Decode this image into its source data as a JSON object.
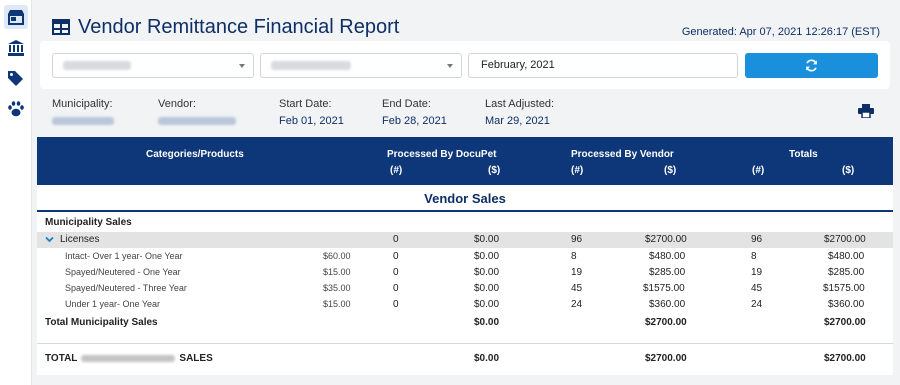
{
  "sidebar": {
    "items": [
      {
        "icon": "store-icon",
        "active": true
      },
      {
        "icon": "bank-icon"
      },
      {
        "icon": "tags-icon"
      },
      {
        "icon": "paw-icon"
      }
    ]
  },
  "header": {
    "title": "Vendor Remittance Financial Report",
    "generated": "Generated: Apr 07, 2021 12:26:17 (EST)"
  },
  "filters": {
    "period_value": "February, 2021"
  },
  "meta": {
    "municipality_label": "Municipality:",
    "vendor_label": "Vendor:",
    "start_date_label": "Start Date:",
    "start_date": "Feb 01, 2021",
    "end_date_label": "End Date:",
    "end_date": "Feb 28, 2021",
    "last_adjusted_label": "Last Adjusted:",
    "last_adjusted": "Mar 29, 2021"
  },
  "table": {
    "col_categories": "Categories/Products",
    "col_docupet": "Processed By DocuPet",
    "col_vendor": "Processed By Vendor",
    "col_totals": "Totals",
    "sub_count": "(#)",
    "sub_amount": "($)",
    "section_title": "Vendor Sales",
    "municipality_sales": "Municipality Sales",
    "licenses": {
      "label": "Licenses",
      "docupet_count": "0",
      "docupet_amount": "$0.00",
      "vendor_count": "96",
      "vendor_amount": "$2700.00",
      "total_count": "96",
      "total_amount": "$2700.00"
    },
    "products": [
      {
        "name": "Intact- Over 1 year- One Year",
        "price": "$60.00",
        "docupet_count": "0",
        "docupet_amount": "$0.00",
        "vendor_count": "8",
        "vendor_amount": "$480.00",
        "total_count": "8",
        "total_amount": "$480.00"
      },
      {
        "name": "Spayed/Neutered - One Year",
        "price": "$15.00",
        "docupet_count": "0",
        "docupet_amount": "$0.00",
        "vendor_count": "19",
        "vendor_amount": "$285.00",
        "total_count": "19",
        "total_amount": "$285.00"
      },
      {
        "name": "Spayed/Neutered - Three Year",
        "price": "$35.00",
        "docupet_count": "0",
        "docupet_amount": "$0.00",
        "vendor_count": "45",
        "vendor_amount": "$1575.00",
        "total_count": "45",
        "total_amount": "$1575.00"
      },
      {
        "name": "Under 1 year- One Year",
        "price": "$15.00",
        "docupet_count": "0",
        "docupet_amount": "$0.00",
        "vendor_count": "24",
        "vendor_amount": "$360.00",
        "total_count": "24",
        "total_amount": "$360.00"
      }
    ],
    "total_municipality": {
      "label": "Total Municipality Sales",
      "docupet_amount": "$0.00",
      "vendor_amount": "$2700.00",
      "total_amount": "$2700.00"
    },
    "grand_total": {
      "label_prefix": "TOTAL",
      "label_suffix": "SALES",
      "docupet_amount": "$0.00",
      "vendor_amount": "$2700.00",
      "total_amount": "$2700.00"
    }
  }
}
